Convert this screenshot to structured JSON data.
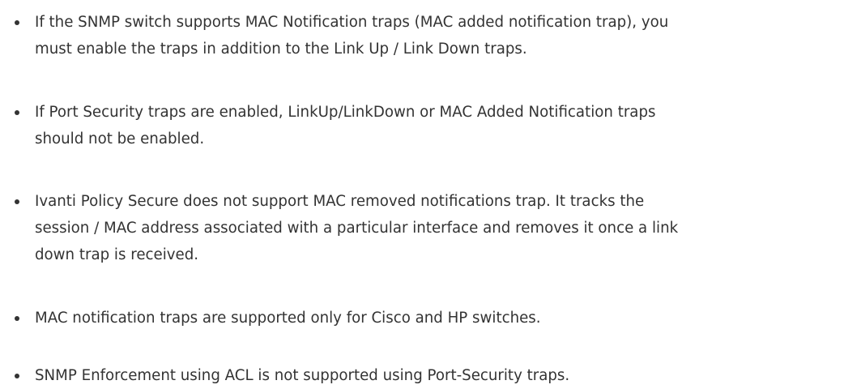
{
  "bullets": [
    {
      "lines": [
        "If the SNMP switch supports MAC Notification traps (MAC added notification trap), you",
        "must enable the traps in addition to the Link Up / Link Down traps."
      ]
    },
    {
      "lines": [
        "If Port Security traps are enabled, LinkUp/LinkDown or MAC Added Notification traps",
        "should not be enabled."
      ]
    },
    {
      "lines": [
        "Ivanti Policy Secure does not support MAC removed notifications trap. It tracks the",
        "session / MAC address associated with a particular interface and removes it once a link",
        "down trap is received."
      ]
    },
    {
      "lines": [
        "MAC notification traps are supported only for Cisco and HP switches."
      ]
    },
    {
      "lines": [
        "SNMP Enforcement using ACL is not supported using Port-Security traps."
      ]
    }
  ]
}
